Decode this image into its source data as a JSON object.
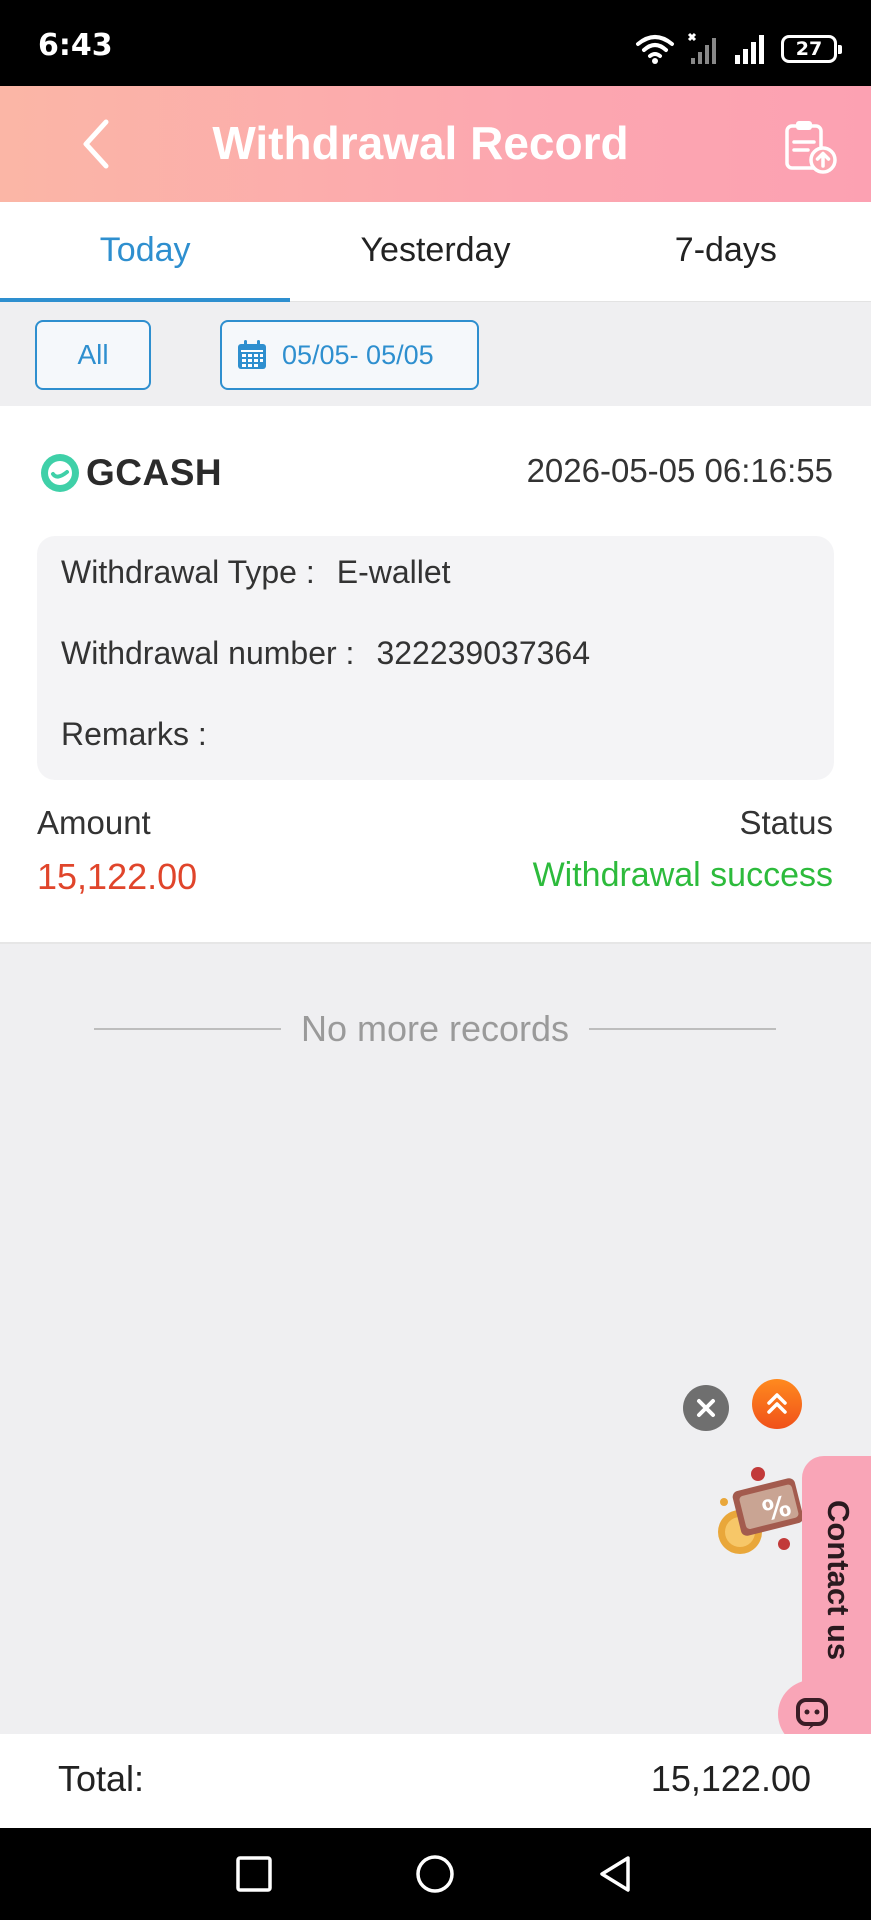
{
  "status_bar": {
    "time": "6:43",
    "battery": "27"
  },
  "header": {
    "title": "Withdrawal Record"
  },
  "tabs": [
    {
      "label": "Today",
      "active": true
    },
    {
      "label": "Yesterday",
      "active": false
    },
    {
      "label": "7-days",
      "active": false
    }
  ],
  "filters": {
    "all_label": "All",
    "date_range": "05/05- 05/05"
  },
  "record": {
    "brand": "GCASH",
    "datetime": "2026-05-05 06:16:55",
    "type_label": "Withdrawal Type :",
    "type_value": "E-wallet",
    "number_label": "Withdrawal number :",
    "number_value": "322239037364",
    "remarks_label": "Remarks :",
    "remarks_value": "",
    "amount_label": "Amount",
    "amount_value": "15,122.00",
    "status_label": "Status",
    "status_value": "Withdrawal success"
  },
  "list_end": "No more records",
  "contact": {
    "label": "Contact us"
  },
  "total": {
    "label": "Total:",
    "value": "15,122.00"
  },
  "colors": {
    "accent": "#2e8fcf",
    "amount": "#e0452b",
    "success": "#2dbb3c",
    "header_gradient_start": "#fbb6a6",
    "header_gradient_end": "#fca1b2"
  }
}
